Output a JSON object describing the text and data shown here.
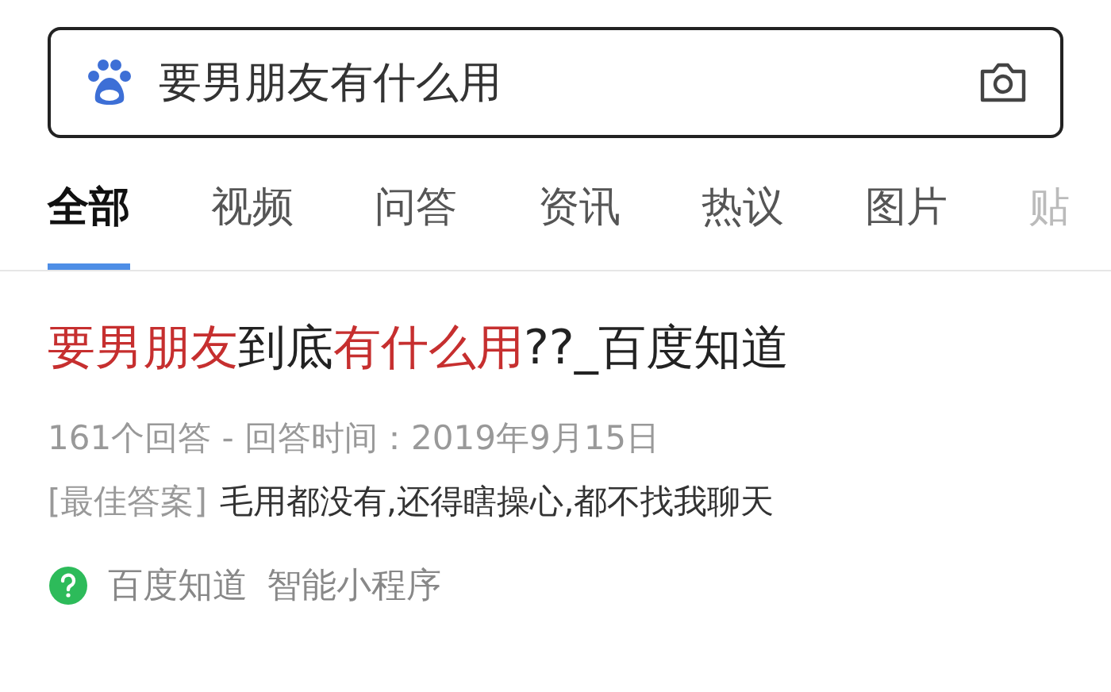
{
  "search": {
    "value": "要男朋友有什么用"
  },
  "tabs": [
    {
      "label": "全部",
      "selected": true
    },
    {
      "label": "视频",
      "selected": false
    },
    {
      "label": "问答",
      "selected": false
    },
    {
      "label": "资讯",
      "selected": false
    },
    {
      "label": "热议",
      "selected": false
    },
    {
      "label": "图片",
      "selected": false
    },
    {
      "label": "贴",
      "selected": false
    }
  ],
  "result": {
    "title": [
      {
        "text": "要男朋友",
        "highlight": true
      },
      {
        "text": "到底",
        "highlight": false
      },
      {
        "text": "有什么用",
        "highlight": true
      },
      {
        "text": "??_百度知道",
        "highlight": false
      }
    ],
    "meta": "161个回答 - 回答时间：2019年9月15日",
    "answer_label": "[最佳答案]",
    "answer": "毛用都没有,还得瞎操心,都不找我聊天",
    "source": "百度知道",
    "source_note": "智能小程序"
  }
}
